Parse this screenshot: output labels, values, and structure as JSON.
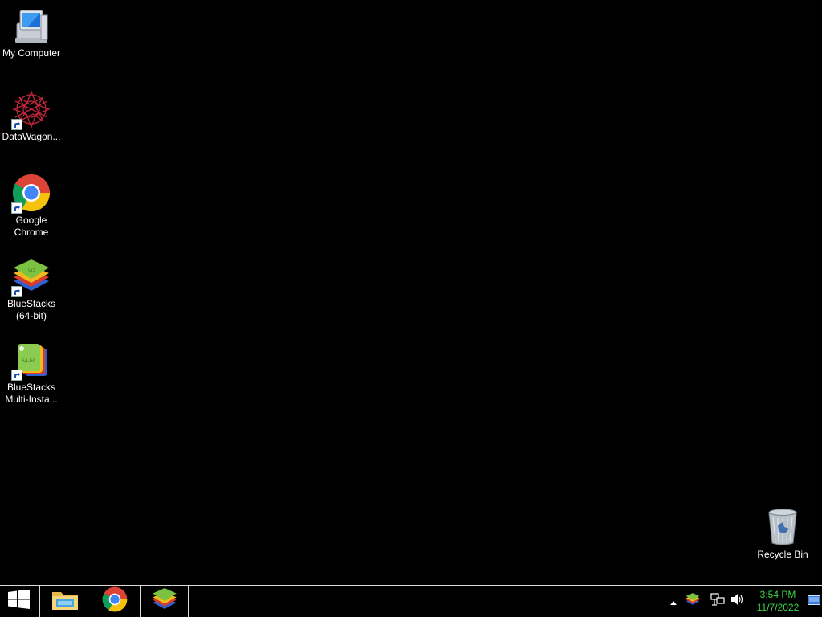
{
  "desktop": {
    "icons": [
      {
        "label": "My Computer",
        "icon": "computer-icon"
      },
      {
        "label": "DataWagon...",
        "icon": "datawagon-icon"
      },
      {
        "label": "Google Chrome",
        "icon": "chrome-icon"
      },
      {
        "label": "BlueStacks (64-bit)",
        "icon": "bluestacks-icon"
      },
      {
        "label": "BlueStacks Multi-Insta...",
        "icon": "bluestacks-multi-instance-icon"
      },
      {
        "label": "Recycle Bin",
        "icon": "recycle-bin-icon"
      }
    ]
  },
  "taskbar": {
    "start_icon": "windows-start-icon",
    "pinned": [
      {
        "icon": "file-explorer-icon"
      },
      {
        "icon": "chrome-icon"
      },
      {
        "icon": "bluestacks-icon"
      }
    ],
    "tray": {
      "icons": [
        "show-hidden-icons-chevron-icon",
        "bluestacks-tray-icon",
        "network-icon",
        "volume-icon",
        "show-desktop-icon"
      ],
      "time": "3:54 PM",
      "date": "11/7/2022",
      "clock_color": "#3fd34a"
    }
  }
}
